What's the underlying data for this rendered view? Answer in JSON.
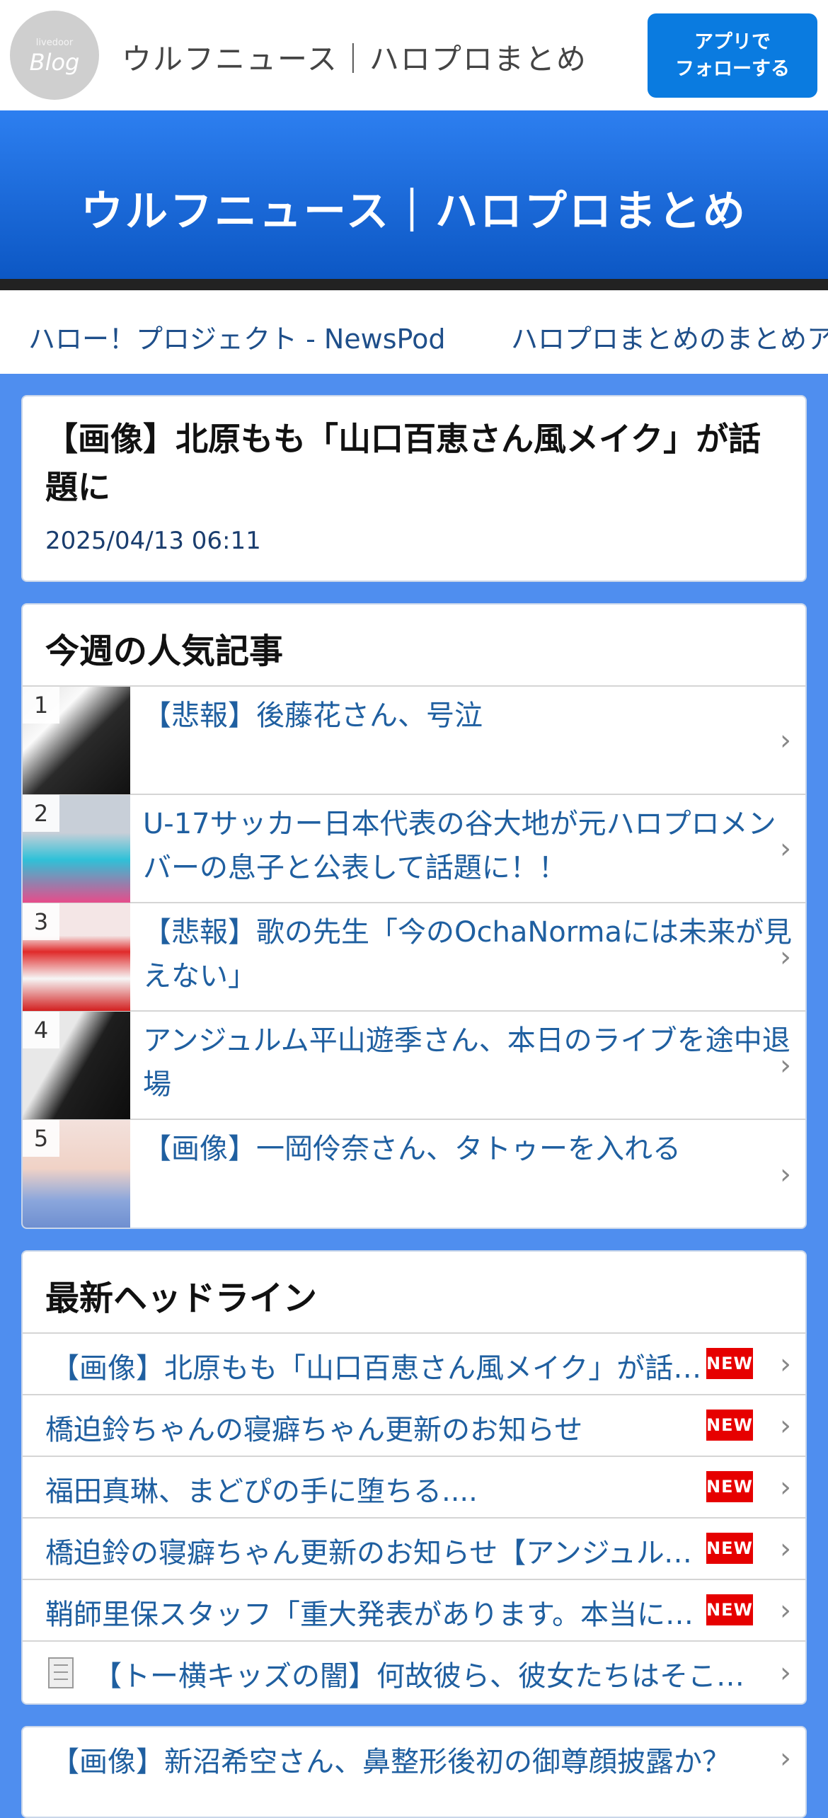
{
  "header": {
    "logo_small": "livedoor",
    "logo_big": "Blog",
    "site_title": "ウルフニュース｜ハロプロまとめ",
    "follow_line1": "アプリで",
    "follow_line2": "フォローする"
  },
  "banner": {
    "title": "ウルフニュース｜ハロプロまとめ"
  },
  "related_links": [
    "ハロー！プロジェクト - NewsPod",
    "ハロプロまとめのまとめア"
  ],
  "article": {
    "title": "【画像】北原もも「山口百恵さん風メイク」が話題に",
    "date": "2025/04/13 06:11"
  },
  "popular": {
    "heading": "今週の人気記事",
    "items": [
      {
        "rank": "1",
        "title": "【悲報】後藤花さん、号泣"
      },
      {
        "rank": "2",
        "title": "U-17サッカー日本代表の谷大地が元ハロプロメンバーの息子と公表して話題に！！"
      },
      {
        "rank": "3",
        "title": "【悲報】歌の先生「今のOchaNormaには未来が見えない」"
      },
      {
        "rank": "4",
        "title": "アンジュルム平山遊季さん、本日のライブを途中退場"
      },
      {
        "rank": "5",
        "title": "【画像】一岡伶奈さん、タトゥーを入れる"
      }
    ]
  },
  "headlines": {
    "heading": "最新ヘッドライン",
    "new_label": "NEW",
    "items": [
      {
        "title": "【画像】北原もも「山口百恵さん風メイク」が話題に"
      },
      {
        "title": "橋迫鈴ちゃんの寝癖ちゃん更新のお知らせ"
      },
      {
        "title": "福田真琳、まどぴの手に堕ちる...."
      },
      {
        "title": "橋迫鈴の寝癖ちゃん更新のお知らせ【アンジュルム】"
      },
      {
        "title": "鞘師里保スタッフ「重大発表があります。本当に大切なお知らせ"
      },
      {
        "title": "【トー横キッズの闇】何故彼ら、彼女たちはそこに集まるのか"
      }
    ]
  },
  "more": {
    "title": "【画像】新沼希空さん、鼻整形後初の御尊顔披露か？"
  },
  "colors": {
    "accent": "#0a7be0",
    "page_bg": "#4f8eef",
    "link": "#1f5fa0",
    "new_badge": "#e60000"
  }
}
